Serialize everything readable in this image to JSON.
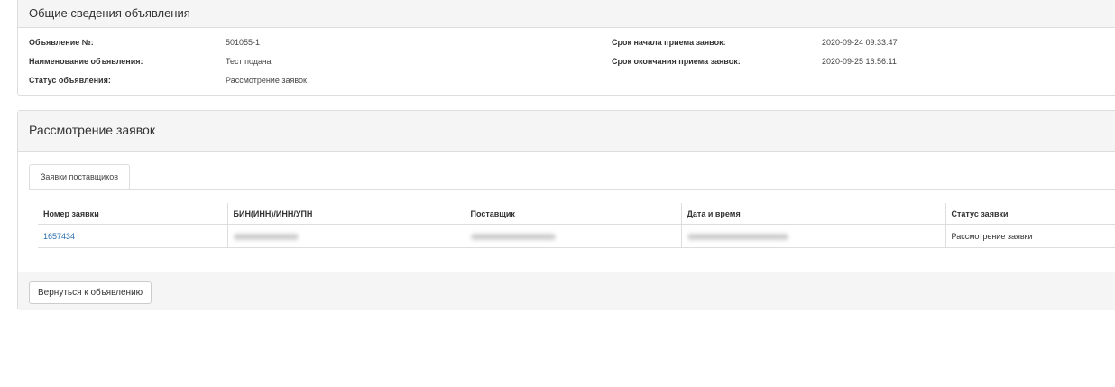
{
  "info_panel": {
    "title": "Общие сведения объявления",
    "fields": {
      "number_label": "Объявление №:",
      "number_value": "501055-1",
      "name_label": "Наименование объявления:",
      "name_value": "Тест подача",
      "status_label": "Статус объявления:",
      "status_value": "Рассмотрение заявок",
      "start_label": "Срок начала приема заявок:",
      "start_value": "2020-09-24 09:33:47",
      "end_label": "Срок окончания приема заявок:",
      "end_value": "2020-09-25 16:56:11"
    }
  },
  "review_panel": {
    "title": "Рассмотрение заявок",
    "tabs": [
      {
        "label": "Заявки поставщиков",
        "active": true
      }
    ],
    "table": {
      "columns": [
        "Номер заявки",
        "БИН(ИНН)/ИНН/УПН",
        "Поставщик",
        "Дата и время",
        "Статус заявки"
      ],
      "rows": [
        {
          "number": "1657434",
          "bin": "",
          "supplier": "",
          "datetime": "",
          "status": "Рассмотрение заявки"
        }
      ]
    },
    "footer": {
      "back_button": "Вернуться к объявлению"
    }
  },
  "colors": {
    "link": "#2a6fb0",
    "panel_heading_bg": "#f5f5f5",
    "border": "#dddddd"
  }
}
